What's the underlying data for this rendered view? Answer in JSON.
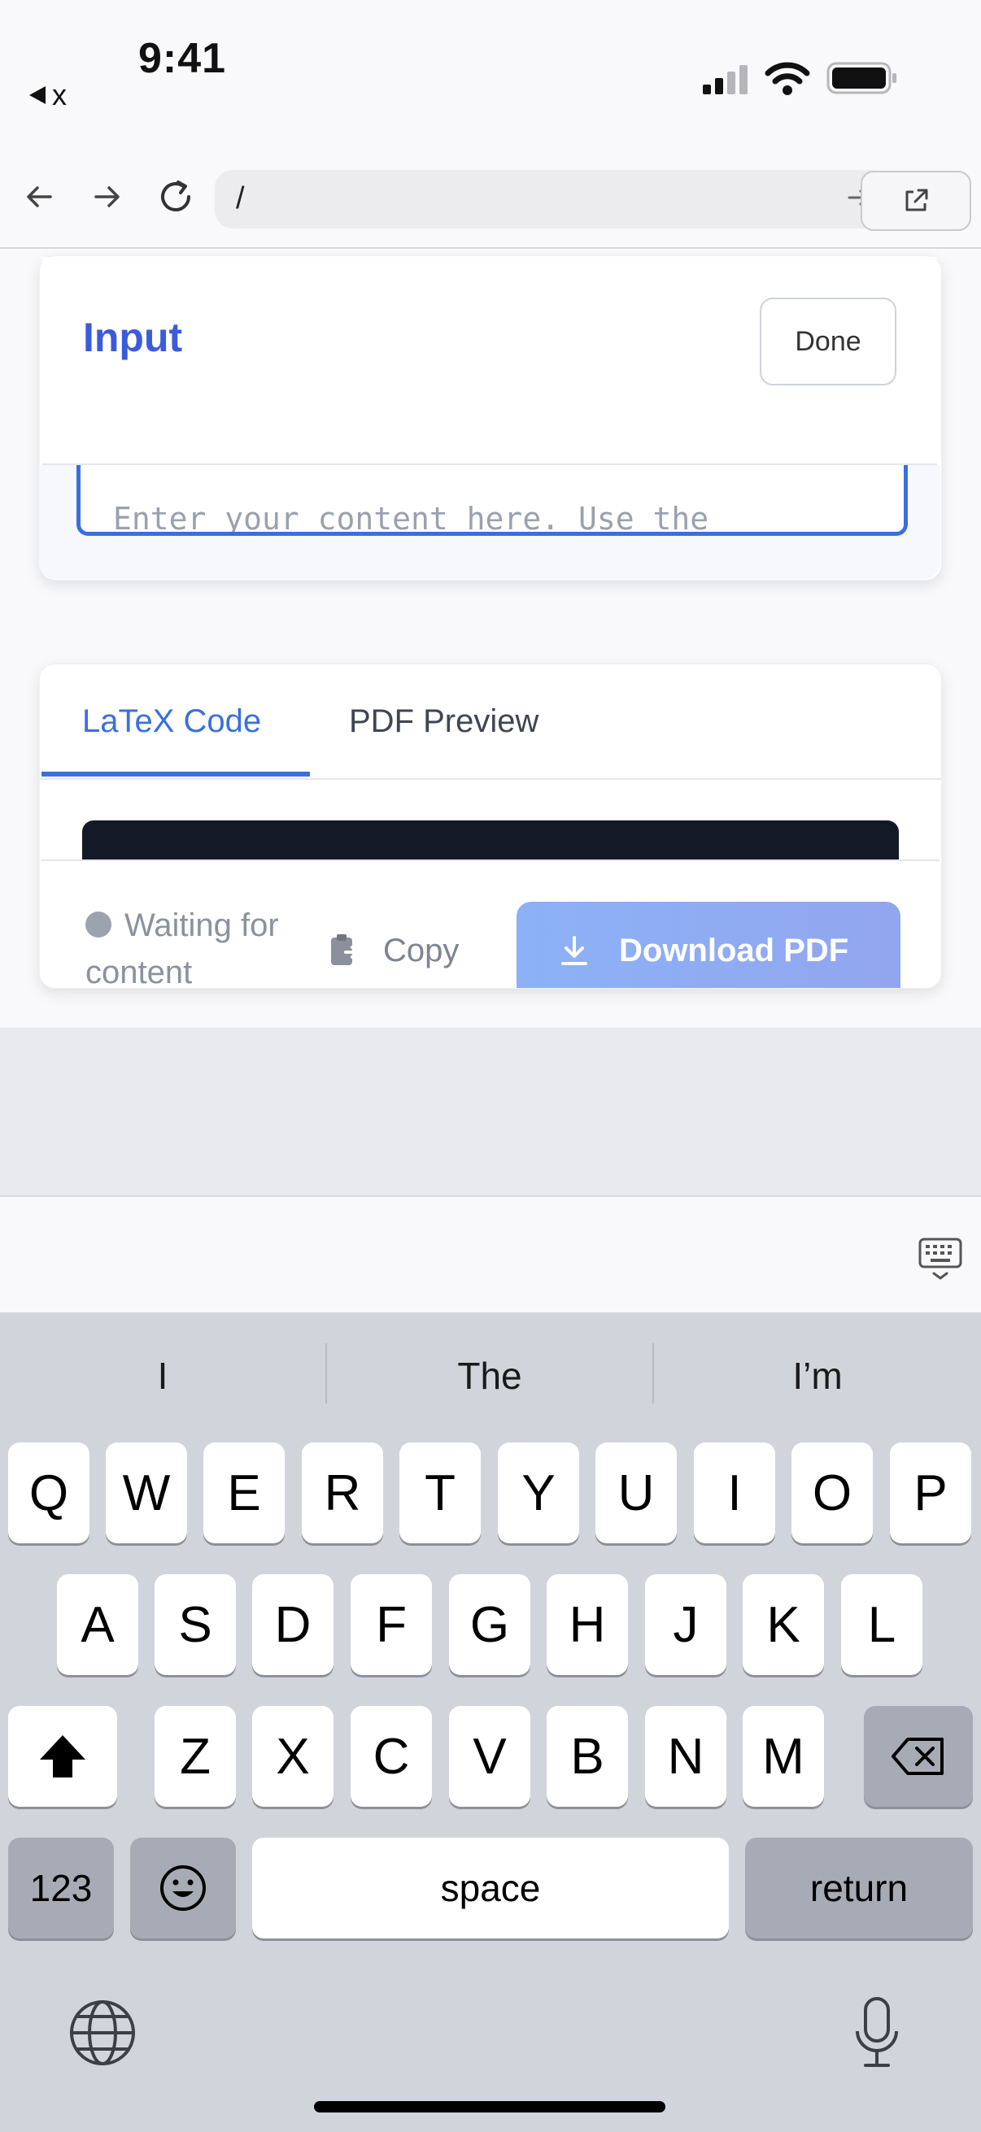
{
  "status_bar": {
    "time": "9:41",
    "back_app": "x"
  },
  "browser": {
    "url": "/"
  },
  "input_card": {
    "title": "Input",
    "done_label": "Done",
    "placeholder": "Enter your content here. Use the"
  },
  "output_card": {
    "tabs": [
      {
        "label": "LaTeX Code",
        "active": true
      },
      {
        "label": "PDF Preview",
        "active": false
      }
    ],
    "status": "Waiting for content",
    "copy_label": "Copy",
    "download_label": "Download PDF"
  },
  "keyboard": {
    "suggestions": [
      "I",
      "The",
      "I’m"
    ],
    "row1": [
      "Q",
      "W",
      "E",
      "R",
      "T",
      "Y",
      "U",
      "I",
      "O",
      "P"
    ],
    "row2": [
      "A",
      "S",
      "D",
      "F",
      "G",
      "H",
      "J",
      "K",
      "L"
    ],
    "row3": [
      "Z",
      "X",
      "C",
      "V",
      "B",
      "N",
      "M"
    ],
    "numbers_label": "123",
    "space_label": "space",
    "return_label": "return"
  },
  "colors": {
    "accent": "#3b6fe0",
    "title": "#3b5bdb",
    "download_bg": "#8cb1f7"
  }
}
